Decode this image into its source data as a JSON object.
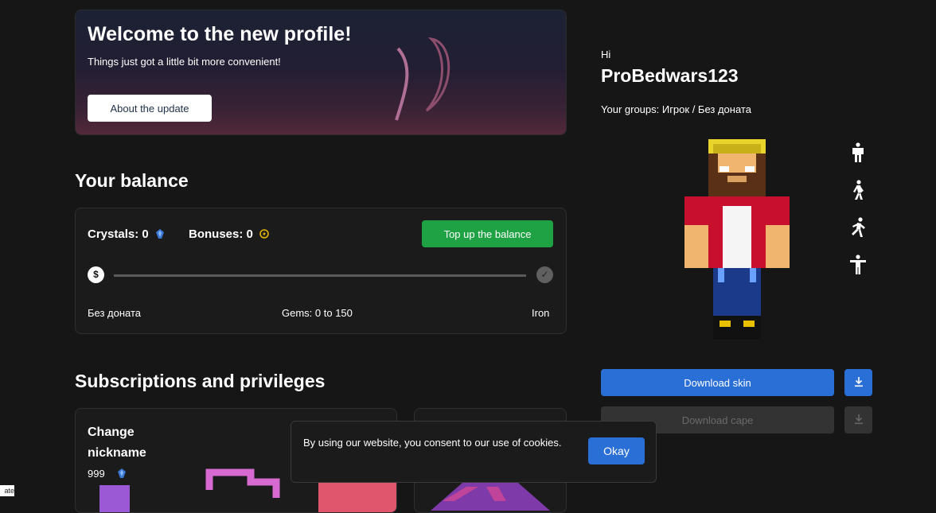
{
  "banner": {
    "title": "Welcome to the new profile!",
    "subtitle": "Things just got a little bit more convenient!",
    "button_label": "About the update"
  },
  "balance": {
    "section_title": "Your balance",
    "crystals_label": "Crystals: 0",
    "bonuses_label": "Bonuses: 0",
    "topup_label": "Top up the balance",
    "progress": 0,
    "start_icon": "$",
    "end_icon": "✓",
    "left_label": "Без доната",
    "middle_label": "Gems: 0 to 150",
    "right_label": "Iron",
    "colors": {
      "crystal": "#3a78d6",
      "bonus": "#e0b400",
      "topup": "#1fa244"
    }
  },
  "subscriptions": {
    "section_title": "Subscriptions and privileges",
    "card1_title_line1": "Change",
    "card1_title_line2": "nickname",
    "card1_price": "999"
  },
  "profile": {
    "greeting": "Hi",
    "username": "ProBedwars123",
    "groups": "Your groups: Игрок / Без доната",
    "pose_icons": [
      "stand-pose-icon",
      "walk-pose-icon",
      "run-pose-icon",
      "tpose-icon"
    ]
  },
  "downloads": {
    "skin_label": "Download skin",
    "cape_label": "Download cape"
  },
  "cookie": {
    "text": "By using our website, you consent to our use of cookies.",
    "okay_label": "Okay"
  },
  "corner_fragment": "ate"
}
